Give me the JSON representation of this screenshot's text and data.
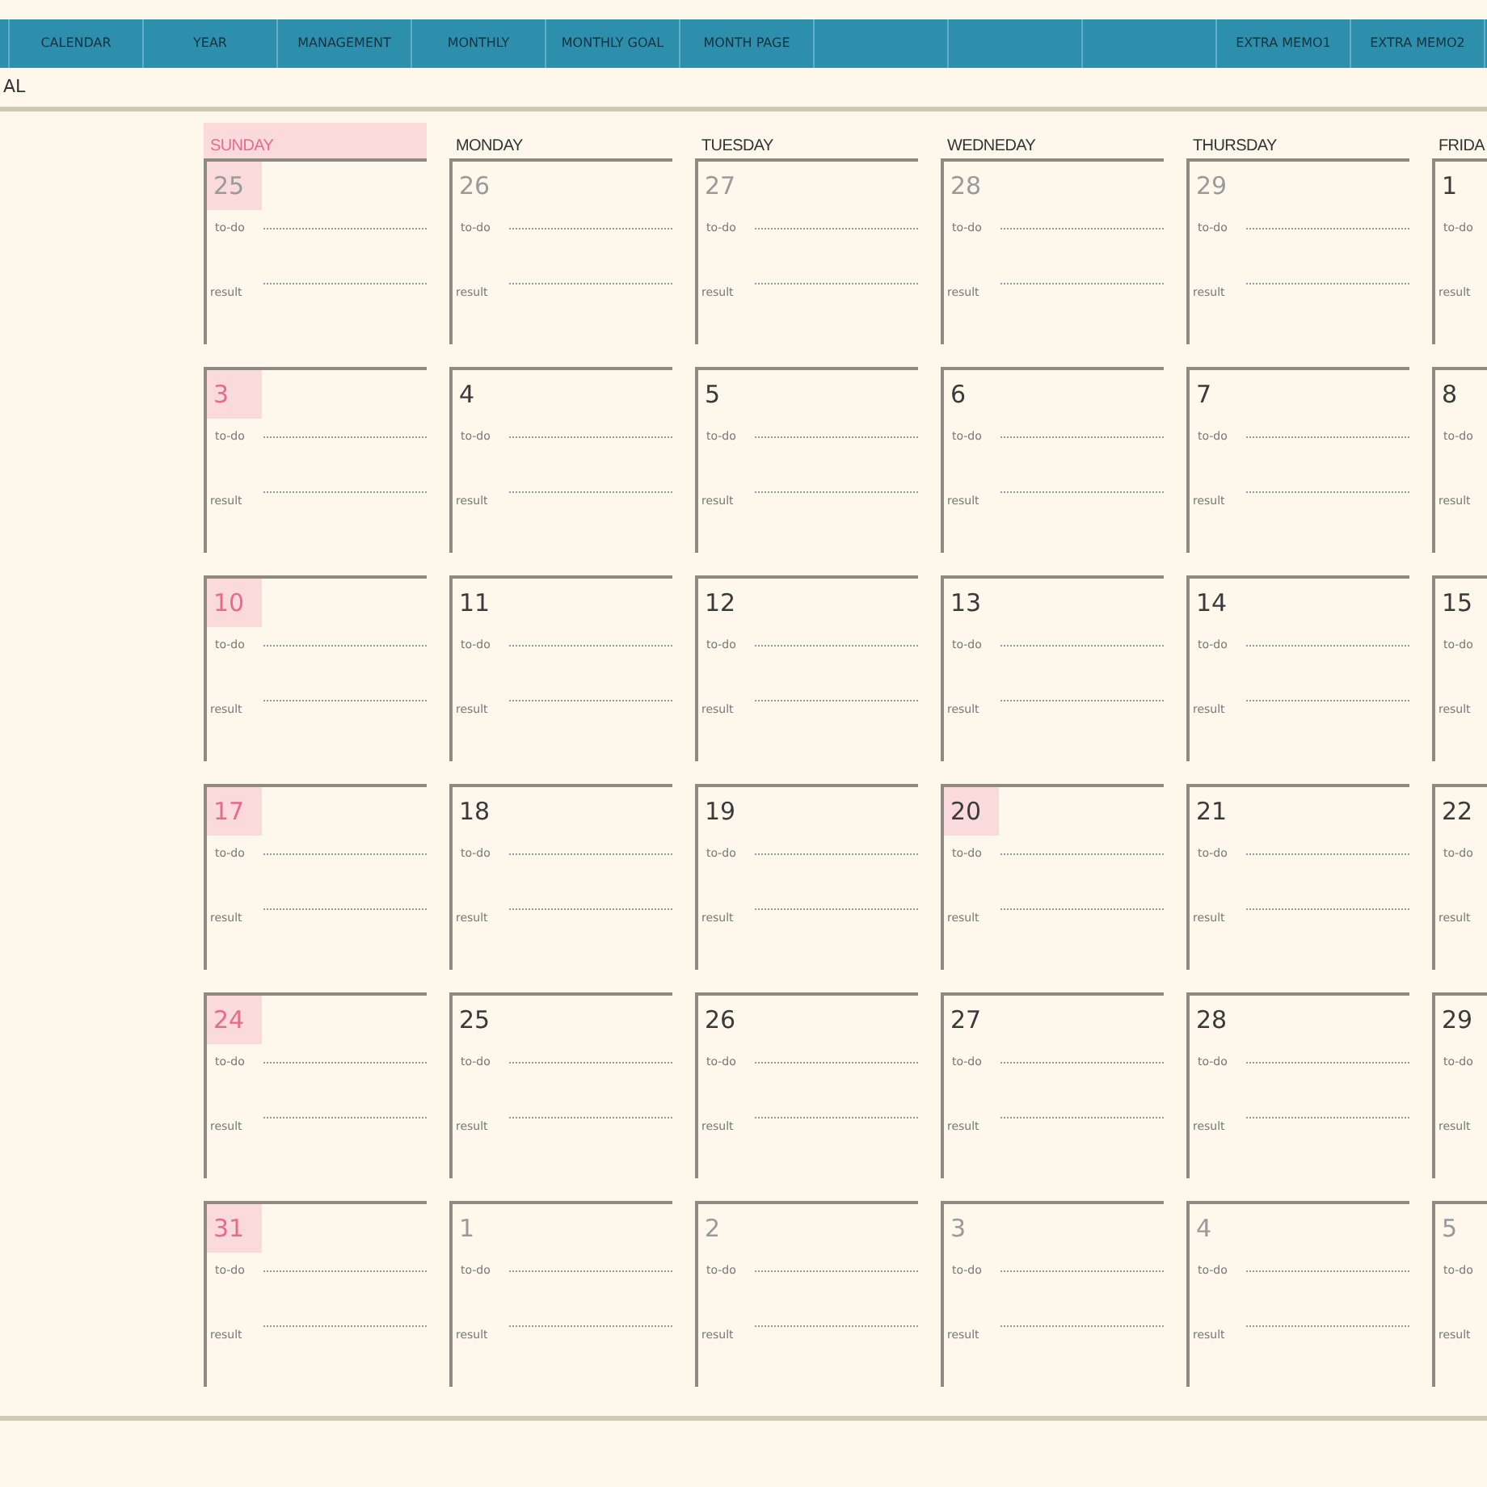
{
  "nav_tabs": [
    {
      "label": "CALENDAR"
    },
    {
      "label": "YEAR"
    },
    {
      "label": "MANAGEMENT"
    },
    {
      "label": "MONTHLY"
    },
    {
      "label": "MONTHLY GOAL"
    },
    {
      "label": "MONTH PAGE"
    }
  ],
  "nav_tabs_right": [
    {
      "label": "EXTRA MEMO1"
    },
    {
      "label": "EXTRA MEMO2"
    }
  ],
  "page_title": "AL",
  "weekdays": [
    {
      "label": "SUNDAY",
      "highlighted": true
    },
    {
      "label": "MONDAY",
      "highlighted": false
    },
    {
      "label": "TUESDAY",
      "highlighted": false
    },
    {
      "label": "WEDNEDAY",
      "highlighted": false
    },
    {
      "label": "THURSDAY",
      "highlighted": false
    },
    {
      "label": "FRIDA",
      "highlighted": false
    }
  ],
  "weeks": [
    [
      {
        "number": "25",
        "muted": true,
        "holiday": false,
        "highlighted": true,
        "lines": [
          "to-do",
          "result"
        ]
      },
      {
        "number": "26",
        "muted": true,
        "holiday": false,
        "highlighted": false,
        "lines": [
          "to-do",
          "result"
        ]
      },
      {
        "number": "27",
        "muted": true,
        "holiday": false,
        "highlighted": false,
        "lines": [
          "to-do",
          "result"
        ]
      },
      {
        "number": "28",
        "muted": true,
        "holiday": false,
        "highlighted": false,
        "lines": [
          "to-do",
          "result"
        ]
      },
      {
        "number": "29",
        "muted": true,
        "holiday": false,
        "highlighted": false,
        "lines": [
          "to-do",
          "result"
        ]
      },
      {
        "number": "1",
        "muted": false,
        "holiday": false,
        "highlighted": false,
        "lines": [
          "to-do",
          "result"
        ]
      }
    ],
    [
      {
        "number": "3",
        "muted": false,
        "holiday": true,
        "highlighted": true,
        "lines": [
          "to-do",
          "result"
        ]
      },
      {
        "number": "4",
        "muted": false,
        "holiday": false,
        "highlighted": false,
        "lines": [
          "to-do",
          "result"
        ]
      },
      {
        "number": "5",
        "muted": false,
        "holiday": false,
        "highlighted": false,
        "lines": [
          "to-do",
          "result"
        ]
      },
      {
        "number": "6",
        "muted": false,
        "holiday": false,
        "highlighted": false,
        "lines": [
          "to-do",
          "result"
        ]
      },
      {
        "number": "7",
        "muted": false,
        "holiday": false,
        "highlighted": false,
        "lines": [
          "to-do",
          "result"
        ]
      },
      {
        "number": "8",
        "muted": false,
        "holiday": false,
        "highlighted": false,
        "lines": [
          "to-do",
          "result"
        ]
      }
    ],
    [
      {
        "number": "10",
        "muted": false,
        "holiday": true,
        "highlighted": true,
        "lines": [
          "to-do",
          "result"
        ]
      },
      {
        "number": "11",
        "muted": false,
        "holiday": false,
        "highlighted": false,
        "lines": [
          "to-do",
          "result"
        ]
      },
      {
        "number": "12",
        "muted": false,
        "holiday": false,
        "highlighted": false,
        "lines": [
          "to-do",
          "result"
        ]
      },
      {
        "number": "13",
        "muted": false,
        "holiday": false,
        "highlighted": false,
        "lines": [
          "to-do",
          "result"
        ]
      },
      {
        "number": "14",
        "muted": false,
        "holiday": false,
        "highlighted": false,
        "lines": [
          "to-do",
          "result"
        ]
      },
      {
        "number": "15",
        "muted": false,
        "holiday": false,
        "highlighted": false,
        "lines": [
          "to-do",
          "result"
        ]
      }
    ],
    [
      {
        "number": "17",
        "muted": false,
        "holiday": true,
        "highlighted": true,
        "lines": [
          "to-do",
          "result"
        ]
      },
      {
        "number": "18",
        "muted": false,
        "holiday": false,
        "highlighted": false,
        "lines": [
          "to-do",
          "result"
        ]
      },
      {
        "number": "19",
        "muted": false,
        "holiday": false,
        "highlighted": false,
        "lines": [
          "to-do",
          "result"
        ]
      },
      {
        "number": "20",
        "muted": false,
        "holiday": false,
        "highlighted": true,
        "lines": [
          "to-do",
          "result"
        ]
      },
      {
        "number": "21",
        "muted": false,
        "holiday": false,
        "highlighted": false,
        "lines": [
          "to-do",
          "result"
        ]
      },
      {
        "number": "22",
        "muted": false,
        "holiday": false,
        "highlighted": false,
        "lines": [
          "to-do",
          "result"
        ]
      }
    ],
    [
      {
        "number": "24",
        "muted": false,
        "holiday": true,
        "highlighted": true,
        "lines": [
          "to-do",
          "result"
        ]
      },
      {
        "number": "25",
        "muted": false,
        "holiday": false,
        "highlighted": false,
        "lines": [
          "to-do",
          "result"
        ]
      },
      {
        "number": "26",
        "muted": false,
        "holiday": false,
        "highlighted": false,
        "lines": [
          "to-do",
          "result"
        ]
      },
      {
        "number": "27",
        "muted": false,
        "holiday": false,
        "highlighted": false,
        "lines": [
          "to-do",
          "result"
        ]
      },
      {
        "number": "28",
        "muted": false,
        "holiday": false,
        "highlighted": false,
        "lines": [
          "to-do",
          "result"
        ]
      },
      {
        "number": "29",
        "muted": false,
        "holiday": false,
        "highlighted": false,
        "lines": [
          "to-do",
          "result"
        ]
      }
    ],
    [
      {
        "number": "31",
        "muted": false,
        "holiday": true,
        "highlighted": true,
        "lines": [
          "to-do",
          "result"
        ]
      },
      {
        "number": "1",
        "muted": true,
        "holiday": false,
        "highlighted": false,
        "lines": [
          "to-do",
          "result"
        ]
      },
      {
        "number": "2",
        "muted": true,
        "holiday": false,
        "highlighted": false,
        "lines": [
          "to-do",
          "result"
        ]
      },
      {
        "number": "3",
        "muted": true,
        "holiday": false,
        "highlighted": false,
        "lines": [
          "to-do",
          "result"
        ]
      },
      {
        "number": "4",
        "muted": true,
        "holiday": false,
        "highlighted": false,
        "lines": [
          "to-do",
          "result"
        ]
      },
      {
        "number": "5",
        "muted": true,
        "holiday": false,
        "highlighted": false,
        "lines": [
          "to-do",
          "result"
        ]
      }
    ]
  ]
}
